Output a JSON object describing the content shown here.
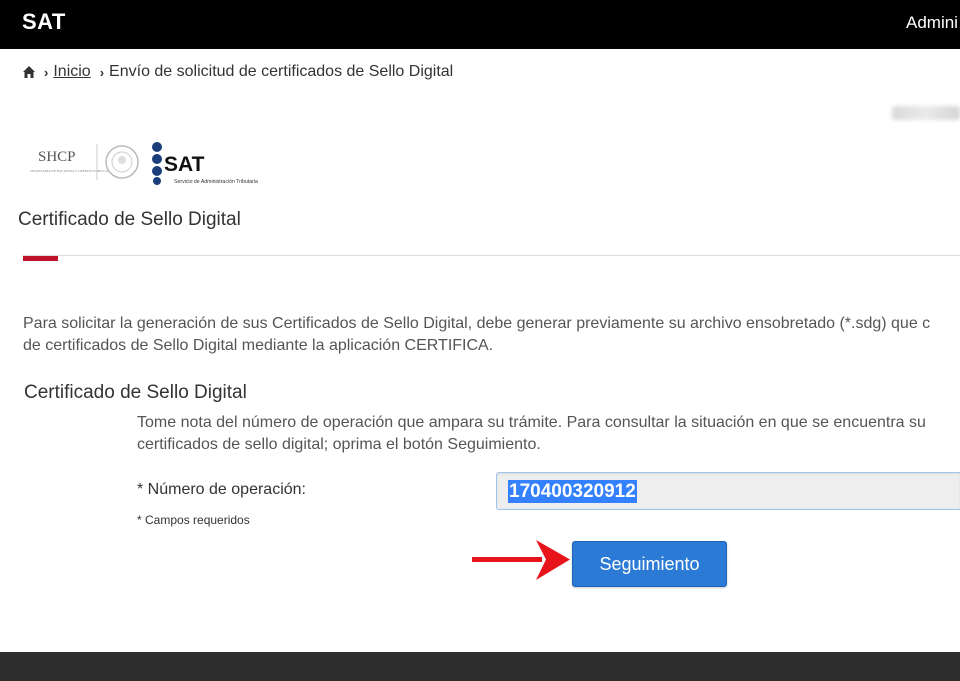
{
  "header": {
    "brand": "SAT",
    "admin_label": "Admini"
  },
  "breadcrumb": {
    "home_label": "Inicio",
    "current": "Envío de solicitud de certificados de Sello Digital"
  },
  "logos": {
    "shcp_text": "SHCP",
    "shcp_subtitle": "SECRETARÍA DE HACIENDA Y CRÉDITO PÚBLICO",
    "sat_text": "SAT",
    "sat_subtitle": "Servicio de Administración Tributaria"
  },
  "page": {
    "title": "Certificado de Sello Digital",
    "intro_line1": "Para solicitar la generación de sus Certificados de Sello Digital, debe generar previamente su archivo ensobretado (*.sdg) que c",
    "intro_line2": "de certificados de Sello Digital mediante la aplicación CERTIFICA."
  },
  "section": {
    "title": "Certificado de Sello Digital",
    "note_line1": "Tome nota del número de operación que ampara su trámite. Para consultar la situación en que se encuentra su",
    "note_line2": "certificados de sello digital; oprima el botón Seguimiento."
  },
  "form": {
    "operation_label": "* Número de operación:",
    "operation_value": "170400320912",
    "required_note": "* Campos requeridos",
    "submit_label": "Seguimiento"
  },
  "colors": {
    "accent_red": "#c0132a",
    "button_blue": "#2b7bd6",
    "arrow_red": "#e8141c"
  }
}
